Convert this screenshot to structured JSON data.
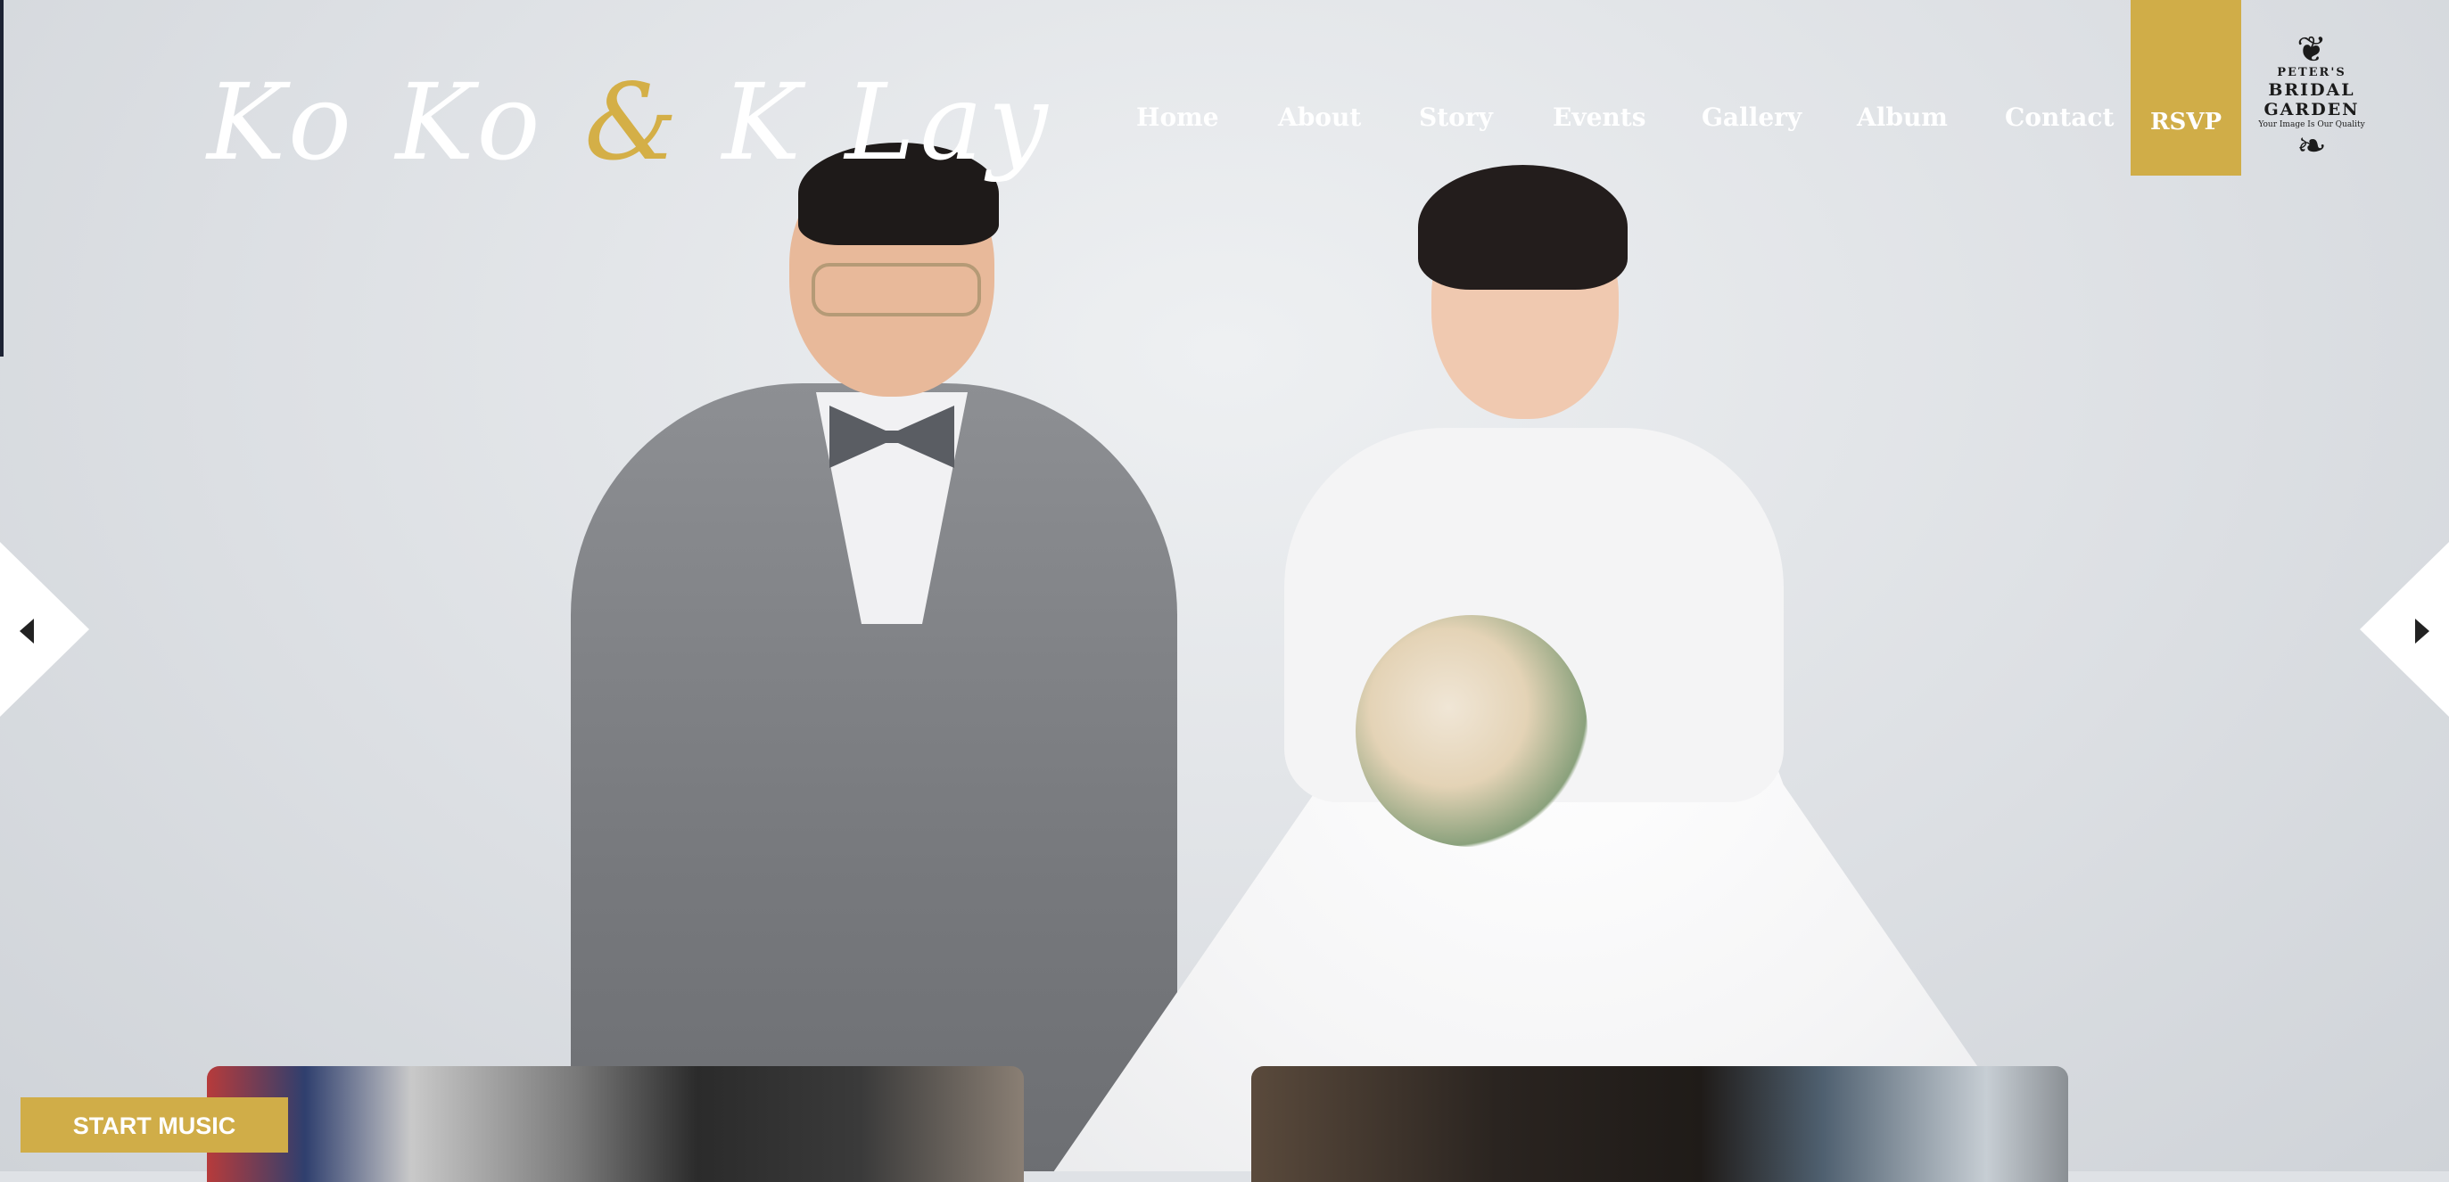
{
  "header": {
    "logo": {
      "left": "Ko Ko",
      "amp": "&",
      "right": "K Lay"
    },
    "nav": [
      "Home",
      "About",
      "Story",
      "Events",
      "Gallery",
      "Album",
      "Contact"
    ],
    "rsvp_label": "RSVP",
    "brand": {
      "line1": "PETER'S",
      "line2": "BRIDAL GARDEN",
      "tagline": "Your Image Is Our Quality"
    }
  },
  "slider": {
    "prev_icon": "caret-left-icon",
    "next_icon": "caret-right-icon"
  },
  "music": {
    "button_label": "START MUSIC"
  },
  "colors": {
    "accent": "#d0ad48",
    "nav_text": "#ffffff",
    "background": "#dfe2e6"
  }
}
